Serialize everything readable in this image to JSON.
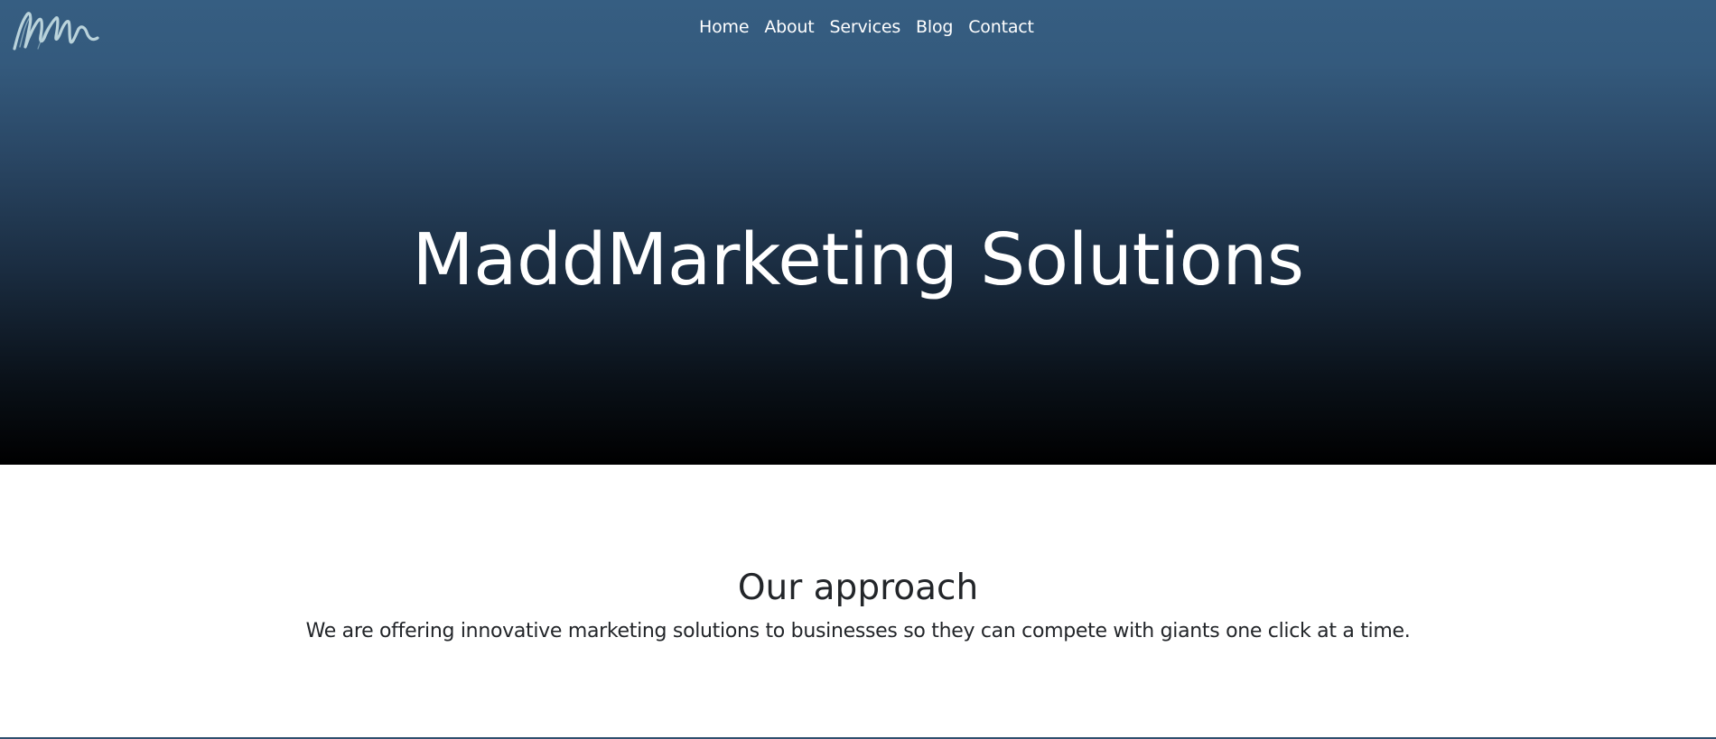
{
  "header": {
    "logo_icon": "handwritten-mm-signature-icon",
    "nav": [
      {
        "label": "Home"
      },
      {
        "label": "About"
      },
      {
        "label": "Services"
      },
      {
        "label": "Blog"
      },
      {
        "label": "Contact"
      }
    ]
  },
  "hero": {
    "title": "MaddMarketing Solutions",
    "gradient_top": "#365e82",
    "gradient_bottom": "#000000"
  },
  "approach": {
    "heading": "Our approach",
    "text": "We are offering innovative marketing solutions to businesses so they can compete with giants one click at a time."
  },
  "colors": {
    "text_dark": "#222529",
    "text_light": "#ffffff"
  }
}
